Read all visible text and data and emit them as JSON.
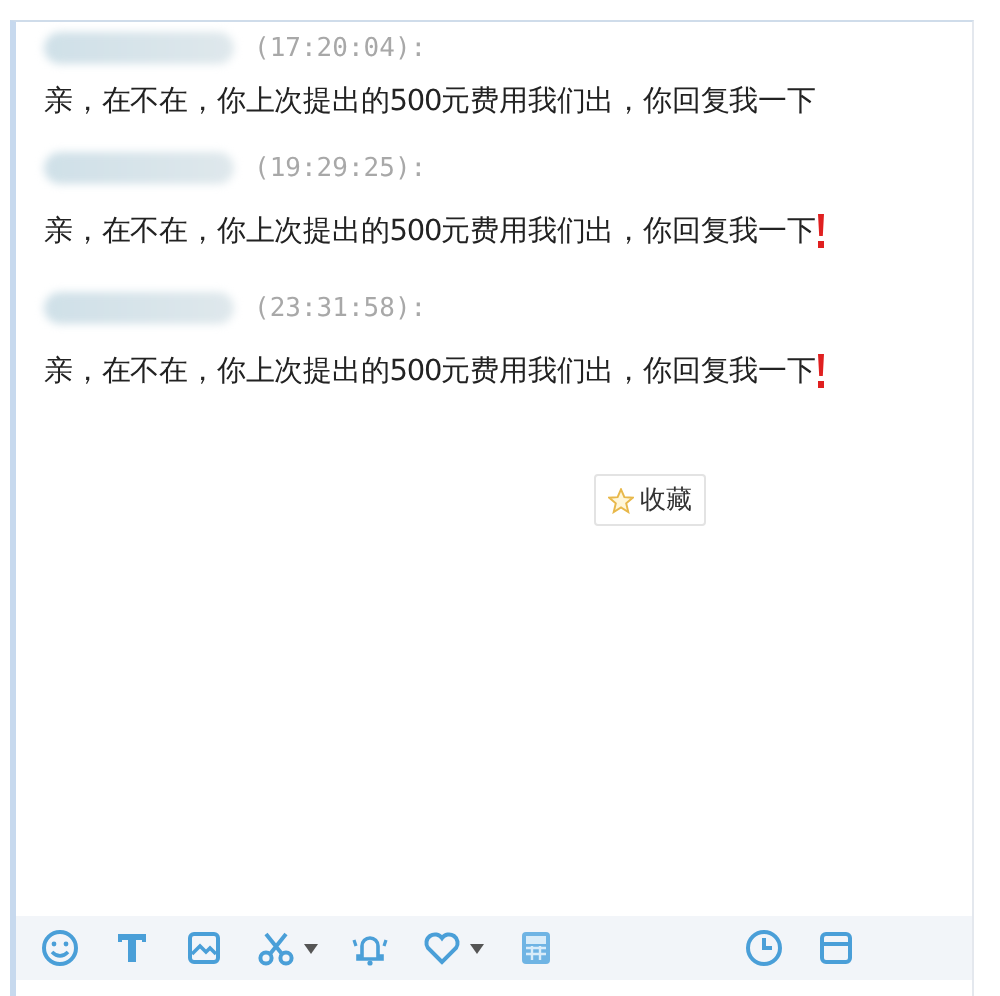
{
  "messages": [
    {
      "time": "(17:20:04):",
      "text": "亲，在不在，你上次提出的500元费用我们出，你回复我一下",
      "exclaimed": false
    },
    {
      "time": "(19:29:25):",
      "text": "亲，在不在，你上次提出的500元费用我们出，你回复我一下",
      "exclaimed": true
    },
    {
      "time": "(23:31:58):",
      "text": "亲，在不在，你上次提出的500元费用我们出，你回复我一下",
      "exclaimed": true
    }
  ],
  "bookmark_button": {
    "label": "收藏"
  },
  "toolbar": [
    {
      "kind": "emoji",
      "dropdown": false
    },
    {
      "kind": "font",
      "dropdown": false
    },
    {
      "kind": "image",
      "dropdown": false
    },
    {
      "kind": "scissors",
      "dropdown": true
    },
    {
      "kind": "bell",
      "dropdown": false
    },
    {
      "kind": "heart",
      "dropdown": true
    },
    {
      "kind": "grid",
      "dropdown": false
    },
    {
      "kind": "history",
      "dropdown": false
    },
    {
      "kind": "window",
      "dropdown": false
    }
  ]
}
